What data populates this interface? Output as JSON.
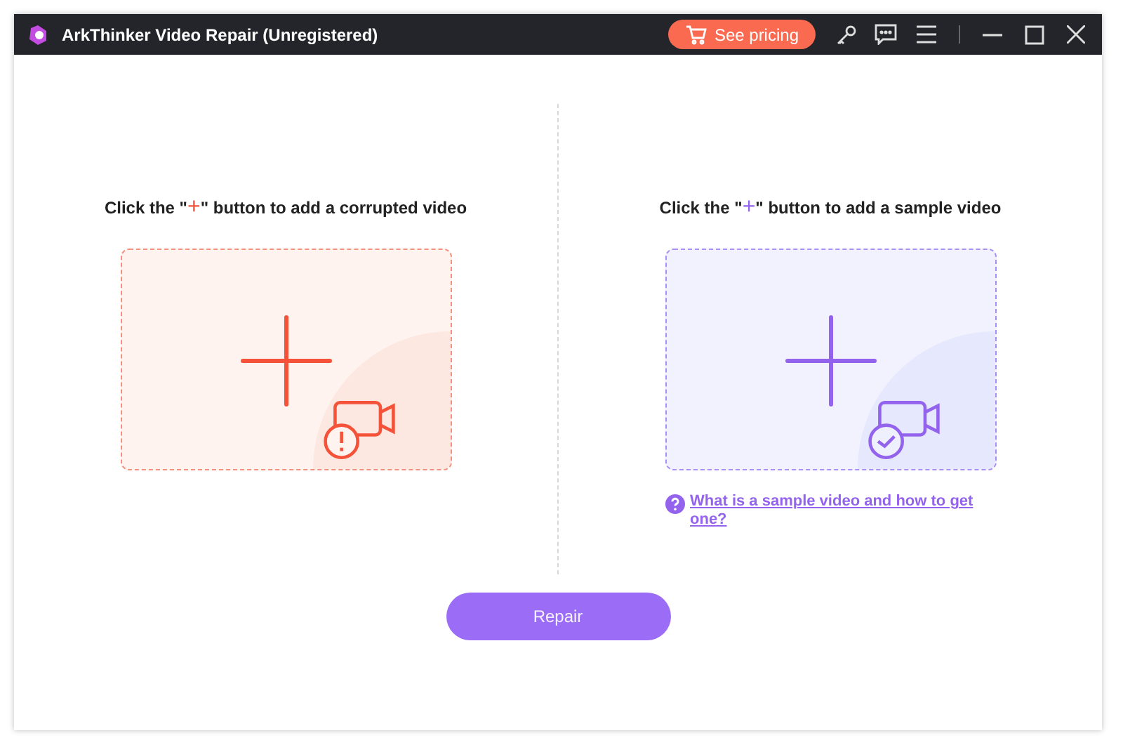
{
  "window": {
    "title": "ArkThinker Video Repair (Unregistered)",
    "pricing_button": "See pricing"
  },
  "panels": [
    {
      "kind": "corrupted",
      "before": "Click the \"",
      "mark": "+",
      "after": "\" button to add a corrupted video"
    },
    {
      "kind": "sample",
      "before": "Click the \"",
      "mark": "+",
      "after": "\" button to add a sample video",
      "help_link": "What is a sample video and how to get one?"
    }
  ],
  "repair_button": "Repair"
}
